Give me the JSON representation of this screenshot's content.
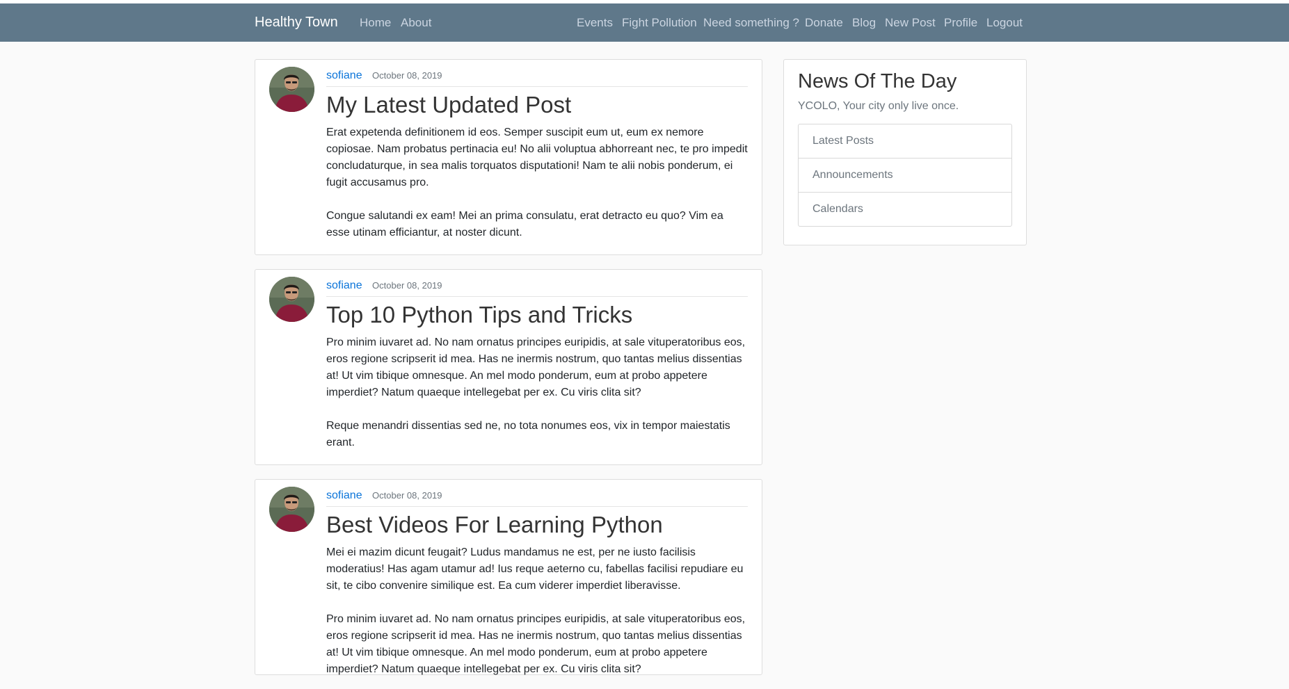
{
  "navbar": {
    "brand": "Healthy Town",
    "left_links": [
      "Home",
      "About"
    ],
    "right_links": [
      "Events",
      "Fight Pollution",
      "Need something ?",
      "Donate",
      "Blog",
      "New Post",
      "Profile",
      "Logout"
    ]
  },
  "posts": [
    {
      "author": "sofiane",
      "date": "October 08, 2019",
      "title": "My Latest Updated Post",
      "paragraphs": [
        "Erat expetenda definitionem id eos. Semper suscipit eum ut, eum ex nemore copiosae. Nam probatus pertinacia eu! No alii voluptua abhorreant nec, te pro impedit concludaturque, in sea malis torquatos disputationi! Nam te alii nobis ponderum, ei fugit accusamus pro.",
        "Congue salutandi ex eam! Mei an prima consulatu, erat detracto eu quo? Vim ea esse utinam efficiantur, at noster dicunt."
      ]
    },
    {
      "author": "sofiane",
      "date": "October 08, 2019",
      "title": "Top 10 Python Tips and Tricks",
      "paragraphs": [
        "Pro minim iuvaret ad. No nam ornatus principes euripidis, at sale vituperatoribus eos, eros regione scripserit id mea. Has ne inermis nostrum, quo tantas melius dissentias at! Ut vim tibique omnesque. An mel modo ponderum, eum at probo appetere imperdiet? Natum quaeque intellegebat per ex. Cu viris clita sit?",
        "Reque menandri dissentias sed ne, no tota nonumes eos, vix in tempor maiestatis erant."
      ]
    },
    {
      "author": "sofiane",
      "date": "October 08, 2019",
      "title": "Best Videos For Learning Python",
      "paragraphs": [
        "Mei ei mazim dicunt feugait? Ludus mandamus ne est, per ne iusto facilisis moderatius! Has agam utamur ad! Ius reque aeterno cu, fabellas facilisi repudiare eu sit, te cibo convenire similique est. Ea cum viderer imperdiet liberavisse.",
        "Pro minim iuvaret ad. No nam ornatus principes euripidis, at sale vituperatoribus eos, eros regione scripserit id mea. Has ne inermis nostrum, quo tantas melius dissentias at! Ut vim tibique omnesque. An mel modo ponderum, eum at probo appetere imperdiet? Natum quaeque intellegebat per ex. Cu viris clita sit?"
      ]
    }
  ],
  "sidebar": {
    "title": "News Of The Day",
    "subtitle": "YCOLO, Your city only live once.",
    "items": [
      "Latest Posts",
      "Announcements",
      "Calendars"
    ]
  },
  "colors": {
    "navbar_bg": "#5f788a",
    "author_link": "#0b74d9",
    "page_bg": "#fafafa"
  }
}
